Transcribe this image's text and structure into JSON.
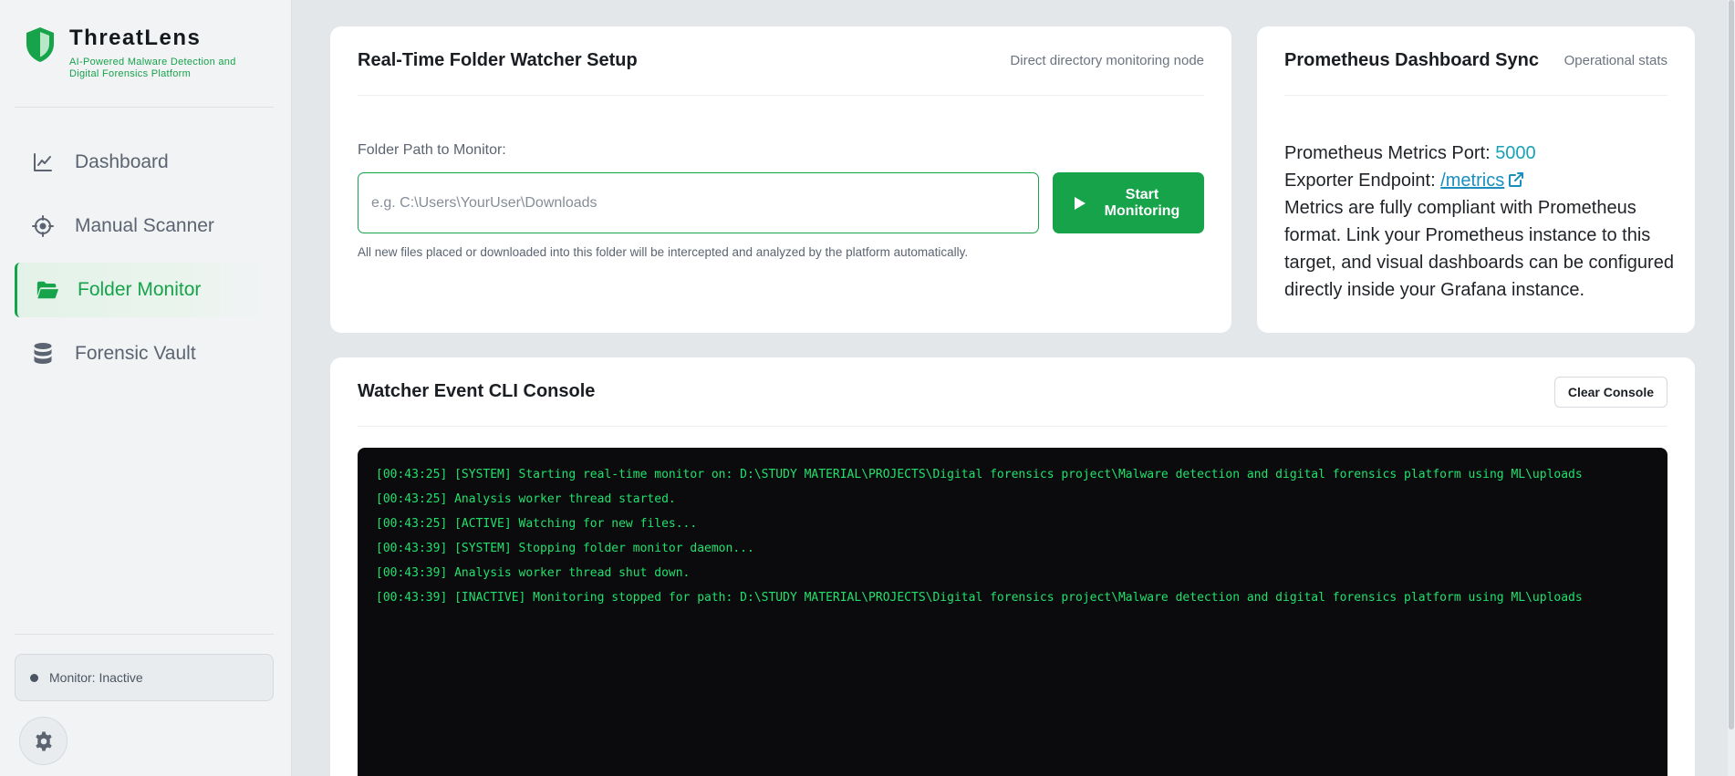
{
  "brand": {
    "title": "ThreatLens",
    "subtitle": "AI-Powered Malware Detection and Digital Forensics Platform"
  },
  "sidebar": {
    "items": [
      {
        "label": "Dashboard",
        "icon": "chart-line-icon",
        "active": false
      },
      {
        "label": "Manual Scanner",
        "icon": "crosshair-icon",
        "active": false
      },
      {
        "label": "Folder Monitor",
        "icon": "folder-open-icon",
        "active": true
      },
      {
        "label": "Forensic Vault",
        "icon": "database-icon",
        "active": false
      }
    ],
    "monitor_status": "Monitor: Inactive"
  },
  "watcher": {
    "title": "Real-Time Folder Watcher Setup",
    "meta": "Direct directory monitoring node",
    "field_label": "Folder Path to Monitor:",
    "input_value": "",
    "input_placeholder": "e.g. C:\\Users\\YourUser\\Downloads",
    "start_label": "Start Monitoring",
    "helper": "All new files placed or downloaded into this folder will be intercepted and analyzed by the platform automatically."
  },
  "prometheus": {
    "title": "Prometheus Dashboard Sync",
    "meta": "Operational stats",
    "port_label": "Prometheus Metrics Port: ",
    "port_value": "5000",
    "endpoint_label": "Exporter Endpoint: ",
    "endpoint_value": "/metrics",
    "description": "Metrics are fully compliant with Prometheus format. Link your Prometheus instance to this target, and visual dashboards can be configured directly inside your Grafana instance."
  },
  "console": {
    "title": "Watcher Event CLI Console",
    "clear_label": "Clear Console",
    "lines": [
      "[00:43:25] [SYSTEM] Starting real-time monitor on: D:\\STUDY MATERIAL\\PROJECTS\\Digital forensics project\\Malware detection and digital forensics platform using ML\\uploads",
      "[00:43:25] Analysis worker thread started.",
      "[00:43:25] [ACTIVE] Watching for new files...",
      "[00:43:39] [SYSTEM] Stopping folder monitor daemon...",
      "[00:43:39] Analysis worker thread shut down.",
      "[00:43:39] [INACTIVE] Monitoring stopped for path: D:\\STUDY MATERIAL\\PROJECTS\\Digital forensics project\\Malware detection and digital forensics platform using ML\\uploads"
    ]
  },
  "colors": {
    "accent": "#16a34a",
    "console_bg": "#0b0b0e",
    "console_text": "#22e06b",
    "link": "#1a8fbf"
  }
}
